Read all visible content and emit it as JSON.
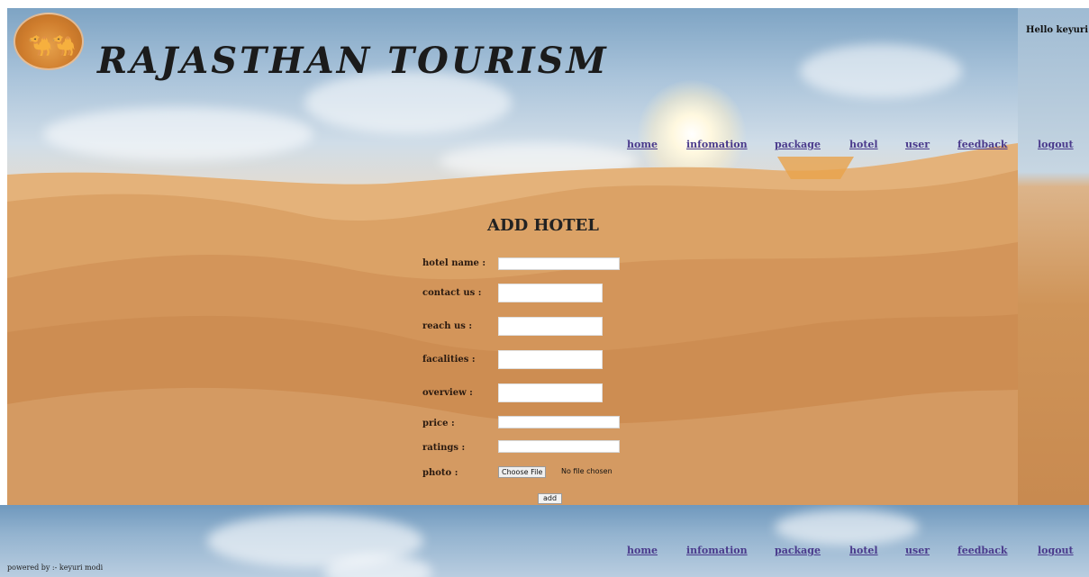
{
  "header": {
    "site_title": "RAJASTHAN TOURISM",
    "greeting": "Hello keyuri"
  },
  "nav": {
    "items": [
      "home",
      "infomation",
      "package",
      "hotel",
      "user",
      "feedback",
      "logout"
    ]
  },
  "form": {
    "title": "ADD HOTEL",
    "fields": [
      {
        "label": "hotel name :",
        "value": ""
      },
      {
        "label": "contact us :",
        "value": ""
      },
      {
        "label": "reach us :",
        "value": ""
      },
      {
        "label": "facalities :",
        "value": ""
      },
      {
        "label": "overview :",
        "value": ""
      },
      {
        "label": "price :",
        "value": ""
      },
      {
        "label": "ratings :",
        "value": ""
      },
      {
        "label": "photo :",
        "value": ""
      }
    ],
    "file_button": "Choose File",
    "file_status": "No file chosen",
    "submit_label": "add"
  },
  "footer": {
    "powered_by": "powered by :- keyuri modi"
  },
  "colors": {
    "nav_link": "#4a3a8c",
    "sand": "#d79a5c",
    "sky": "#8fb3cf"
  },
  "icons": {
    "logo": "camel-rider-icon"
  }
}
